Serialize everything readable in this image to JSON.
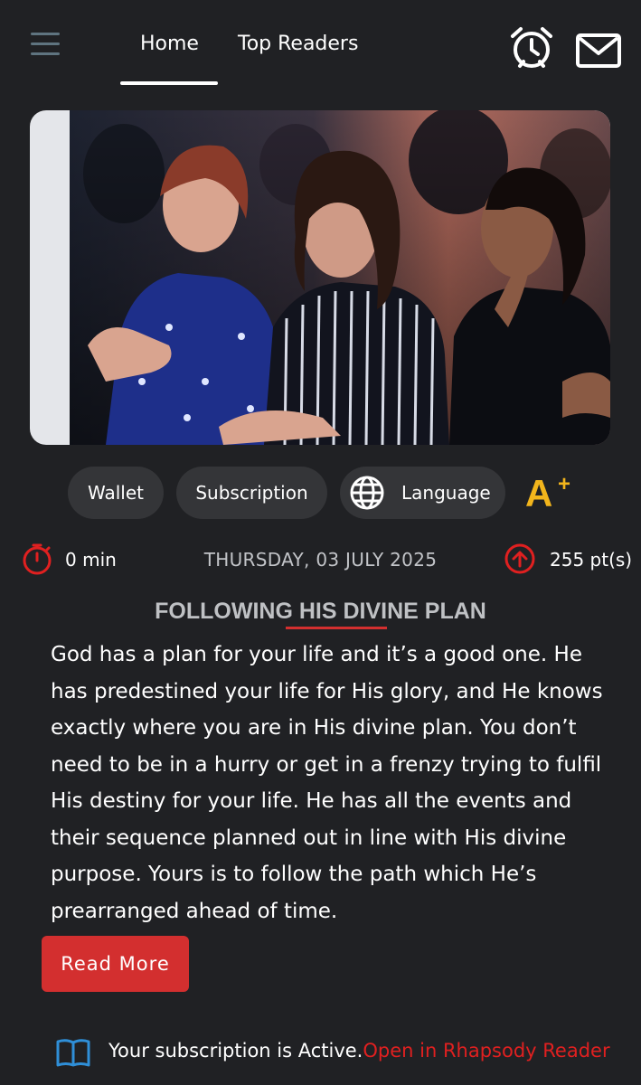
{
  "nav": {
    "tabs": [
      {
        "label": "Home",
        "active": true
      },
      {
        "label": "Top Readers",
        "active": false
      }
    ],
    "icons": [
      "menu-icon",
      "alarm-icon",
      "mail-icon"
    ]
  },
  "hero": {
    "image": "audience-photo"
  },
  "actions": {
    "wallet": "Wallet",
    "subscription": "Subscription",
    "language": "Language",
    "font_size": {
      "letter": "A",
      "plus": "+"
    }
  },
  "stats": {
    "time": "0 min",
    "date": "THURSDAY, 03 JULY 2025",
    "points": "255 pt(s)"
  },
  "article": {
    "title": "FOLLOWING HIS DIVINE PLAN",
    "body": "God has a plan for your life and it’s a good one. He has predestined your life for His glory, and He knows exactly where you are in His divine plan. You don’t need to be in a hurry or get in a frenzy trying to fulfil His destiny for your life. He has all the events and their sequence planned out in line with His divine purpose. Yours is to follow the path which He’s prearranged ahead of time.",
    "read_more": "Read More"
  },
  "footer": {
    "status": "Your subscription is Active.",
    "link": "Open in Rhapsody Reader"
  },
  "colors": {
    "background": "#202124",
    "pill": "#343538",
    "accent_red": "#d32f2f",
    "font_size_yellow": "#f2b51c",
    "book_blue": "#2f8fd8"
  }
}
